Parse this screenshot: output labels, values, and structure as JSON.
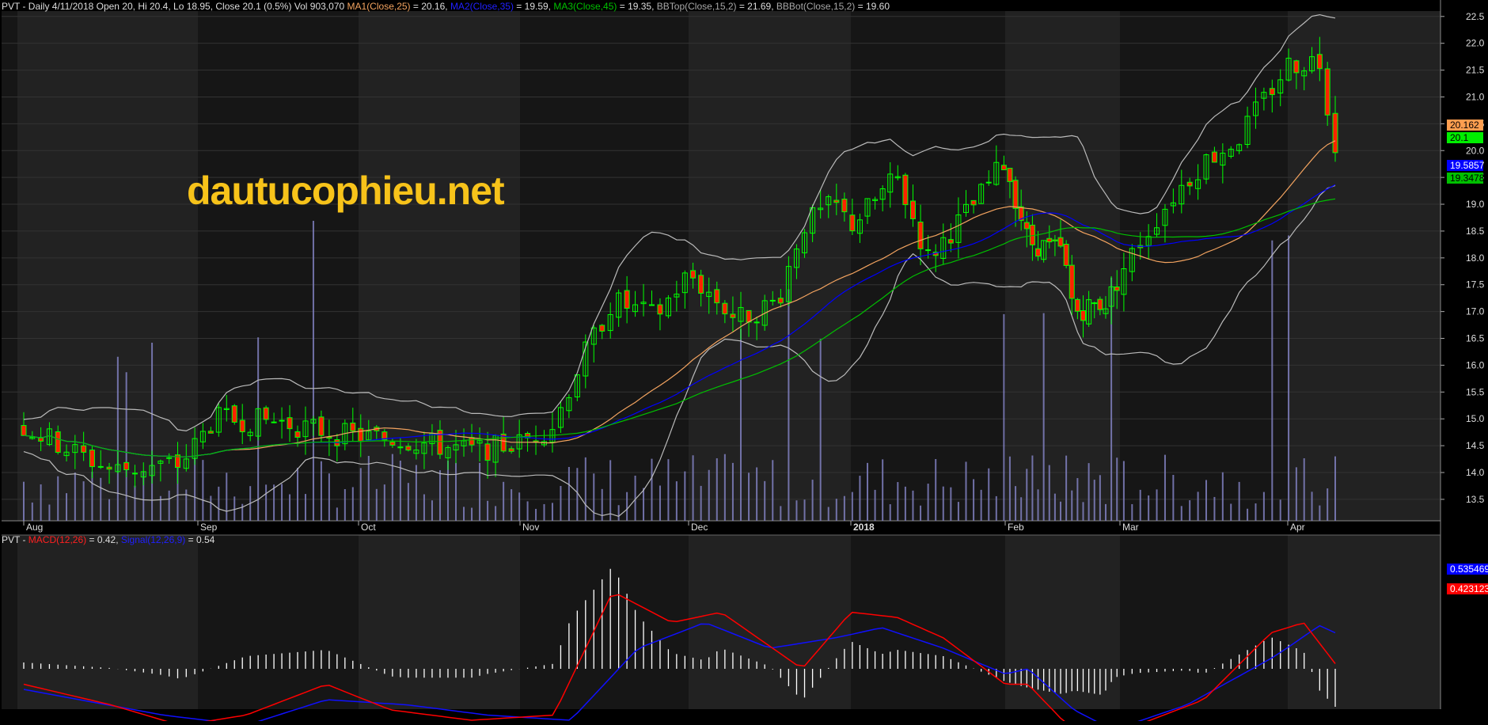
{
  "header": {
    "title": "PVT - Daily 4/11/2018 Open 20, Hi 20.4, Lo 18.95, Close 20.1 (0.5%) Vol 903,070",
    "ma1_label": "MA1(Close,25)",
    "ma1_value": " = 20.16,",
    "ma2_label": "MA2(Close,35)",
    "ma2_value": " = 19.59,",
    "ma3_label": "MA3(Close,45)",
    "ma3_value": " = 19.35,",
    "bbtop_label": "BBTop(Close,15,2)",
    "bbtop_value": " = 21.69,",
    "bbbot_label": "BBBot(Close,15,2)",
    "bbbot_value": " = 19.60"
  },
  "watermark": "dautucophieu.net",
  "macd_header": {
    "prefix": "PVT - ",
    "macd_label": "MACD(12,26)",
    "macd_value": " = 0.42,",
    "signal_label": "Signal(12,26,9)",
    "signal_value": " = 0.54"
  },
  "colors": {
    "up_candle": "#00ff00",
    "down_candle": "#ff2200",
    "ma1": "#f4a460",
    "ma2": "#0000ff",
    "ma3": "#00c000",
    "bollinger": "#bbbbbb",
    "volume": "#8080c0",
    "macd": "#ff0000",
    "signal": "#1010ff",
    "histogram": "#ffffff",
    "ma1_tag": "#ff9e4f",
    "ma2_tag": "#0000ff",
    "ma3_tag": "#00c000",
    "close_tag": "#00ee00"
  },
  "chart_data": [
    {
      "type": "candlestick",
      "title": "PVT - Daily",
      "x_labels": [
        "Aug",
        "Sep",
        "Oct",
        "Nov",
        "Dec",
        "2018",
        "Feb",
        "Mar",
        "Apr"
      ],
      "ylim": [
        13.1,
        22.6
      ],
      "y_ticks": [
        "13.5",
        "14.0",
        "14.5",
        "15.0",
        "15.5",
        "16.0",
        "16.5",
        "17.0",
        "17.5",
        "18.0",
        "18.5",
        "19.0",
        "19.5",
        "20.0",
        "20.5",
        "21.0",
        "21.5",
        "22.0",
        "22.5"
      ],
      "price_tags": {
        "ma1": "20.162",
        "close": "20.1",
        "ma2": "19.5857",
        "ma3": "19.3478"
      },
      "last_bar": {
        "date": "4/11/2018",
        "open": 20,
        "high": 20.4,
        "low": 18.95,
        "close": 20.1,
        "volume": 903070
      },
      "series": [
        {
          "name": "MA1(Close,25)",
          "last": 20.16
        },
        {
          "name": "MA2(Close,35)",
          "last": 19.59
        },
        {
          "name": "MA3(Close,45)",
          "last": 19.35
        },
        {
          "name": "BBTop(Close,15,2)",
          "last": 21.69
        },
        {
          "name": "BBBot(Close,15,2)",
          "last": 19.6
        }
      ],
      "close_path": [
        {
          "m": 0,
          "v": 14.85
        },
        {
          "m": 0.5,
          "v": 14.05
        },
        {
          "m": 0.9,
          "v": 14.15
        },
        {
          "m": 1.1,
          "v": 15.0
        },
        {
          "m": 1.5,
          "v": 14.95
        },
        {
          "m": 1.9,
          "v": 14.7
        },
        {
          "m": 2.3,
          "v": 14.6
        },
        {
          "m": 2.7,
          "v": 14.4
        },
        {
          "m": 3.0,
          "v": 14.55
        },
        {
          "m": 3.2,
          "v": 14.9
        },
        {
          "m": 3.35,
          "v": 16.0
        },
        {
          "m": 3.55,
          "v": 17.2
        },
        {
          "m": 3.8,
          "v": 16.9
        },
        {
          "m": 4.0,
          "v": 17.7
        },
        {
          "m": 4.3,
          "v": 16.85
        },
        {
          "m": 4.55,
          "v": 17.2
        },
        {
          "m": 4.7,
          "v": 18.6
        },
        {
          "m": 4.9,
          "v": 19.0
        },
        {
          "m": 5.0,
          "v": 18.6
        },
        {
          "m": 5.3,
          "v": 19.5
        },
        {
          "m": 5.5,
          "v": 18.0
        },
        {
          "m": 5.8,
          "v": 19.0
        },
        {
          "m": 6.0,
          "v": 19.8
        },
        {
          "m": 6.2,
          "v": 18.3
        },
        {
          "m": 6.5,
          "v": 18.1
        },
        {
          "m": 6.6,
          "v": 17.0
        },
        {
          "m": 6.9,
          "v": 17.2
        },
        {
          "m": 7.1,
          "v": 18.2
        },
        {
          "m": 7.3,
          "v": 19.1
        },
        {
          "m": 7.5,
          "v": 19.8
        },
        {
          "m": 7.7,
          "v": 20.2
        },
        {
          "m": 8.0,
          "v": 21.6
        },
        {
          "m": 8.2,
          "v": 21.7
        },
        {
          "m": 8.3,
          "v": 20.1
        }
      ],
      "volume_note": "volume bars overlaid at bottom of price pane"
    },
    {
      "type": "line",
      "title": "PVT - MACD",
      "series": [
        {
          "name": "MACD(12,26)",
          "last": 0.42
        },
        {
          "name": "Signal(12,26,9)",
          "last": 0.54
        }
      ],
      "price_tags": {
        "signal": "0.535469",
        "macd": "0.423123"
      },
      "macd_path": [
        {
          "m": 0,
          "v": -0.15
        },
        {
          "m": 0.5,
          "v": -0.35
        },
        {
          "m": 0.9,
          "v": -0.55
        },
        {
          "m": 1.3,
          "v": -0.45
        },
        {
          "m": 1.8,
          "v": -0.15
        },
        {
          "m": 2.2,
          "v": -0.4
        },
        {
          "m": 2.7,
          "v": -0.5
        },
        {
          "m": 3.2,
          "v": -0.45
        },
        {
          "m": 3.55,
          "v": 0.75
        },
        {
          "m": 3.9,
          "v": 0.45
        },
        {
          "m": 4.2,
          "v": 0.55
        },
        {
          "m": 4.7,
          "v": 0.0
        },
        {
          "m": 5.0,
          "v": 0.55
        },
        {
          "m": 5.3,
          "v": 0.5
        },
        {
          "m": 5.6,
          "v": 0.3
        },
        {
          "m": 6.0,
          "v": -0.15
        },
        {
          "m": 6.2,
          "v": -0.15
        },
        {
          "m": 6.5,
          "v": -0.5
        },
        {
          "m": 6.85,
          "v": -0.75
        },
        {
          "m": 7.1,
          "v": -0.55
        },
        {
          "m": 7.5,
          "v": -0.3
        },
        {
          "m": 7.9,
          "v": 0.35
        },
        {
          "m": 8.1,
          "v": 0.45
        },
        {
          "m": 8.3,
          "v": 0.05
        }
      ],
      "signal_path": [
        {
          "m": 0,
          "v": -0.2
        },
        {
          "m": 0.8,
          "v": -0.45
        },
        {
          "m": 1.3,
          "v": -0.55
        },
        {
          "m": 1.8,
          "v": -0.3
        },
        {
          "m": 2.3,
          "v": -0.35
        },
        {
          "m": 2.8,
          "v": -0.45
        },
        {
          "m": 3.3,
          "v": -0.5
        },
        {
          "m": 3.7,
          "v": 0.2
        },
        {
          "m": 4.1,
          "v": 0.45
        },
        {
          "m": 4.5,
          "v": 0.2
        },
        {
          "m": 4.9,
          "v": 0.3
        },
        {
          "m": 5.2,
          "v": 0.4
        },
        {
          "m": 5.6,
          "v": 0.2
        },
        {
          "m": 6.0,
          "v": -0.05
        },
        {
          "m": 6.2,
          "v": -0.0
        },
        {
          "m": 6.6,
          "v": -0.4
        },
        {
          "m": 6.95,
          "v": -0.6
        },
        {
          "m": 7.4,
          "v": -0.35
        },
        {
          "m": 7.9,
          "v": 0.1
        },
        {
          "m": 8.2,
          "v": 0.42
        },
        {
          "m": 8.3,
          "v": 0.35
        }
      ]
    }
  ]
}
